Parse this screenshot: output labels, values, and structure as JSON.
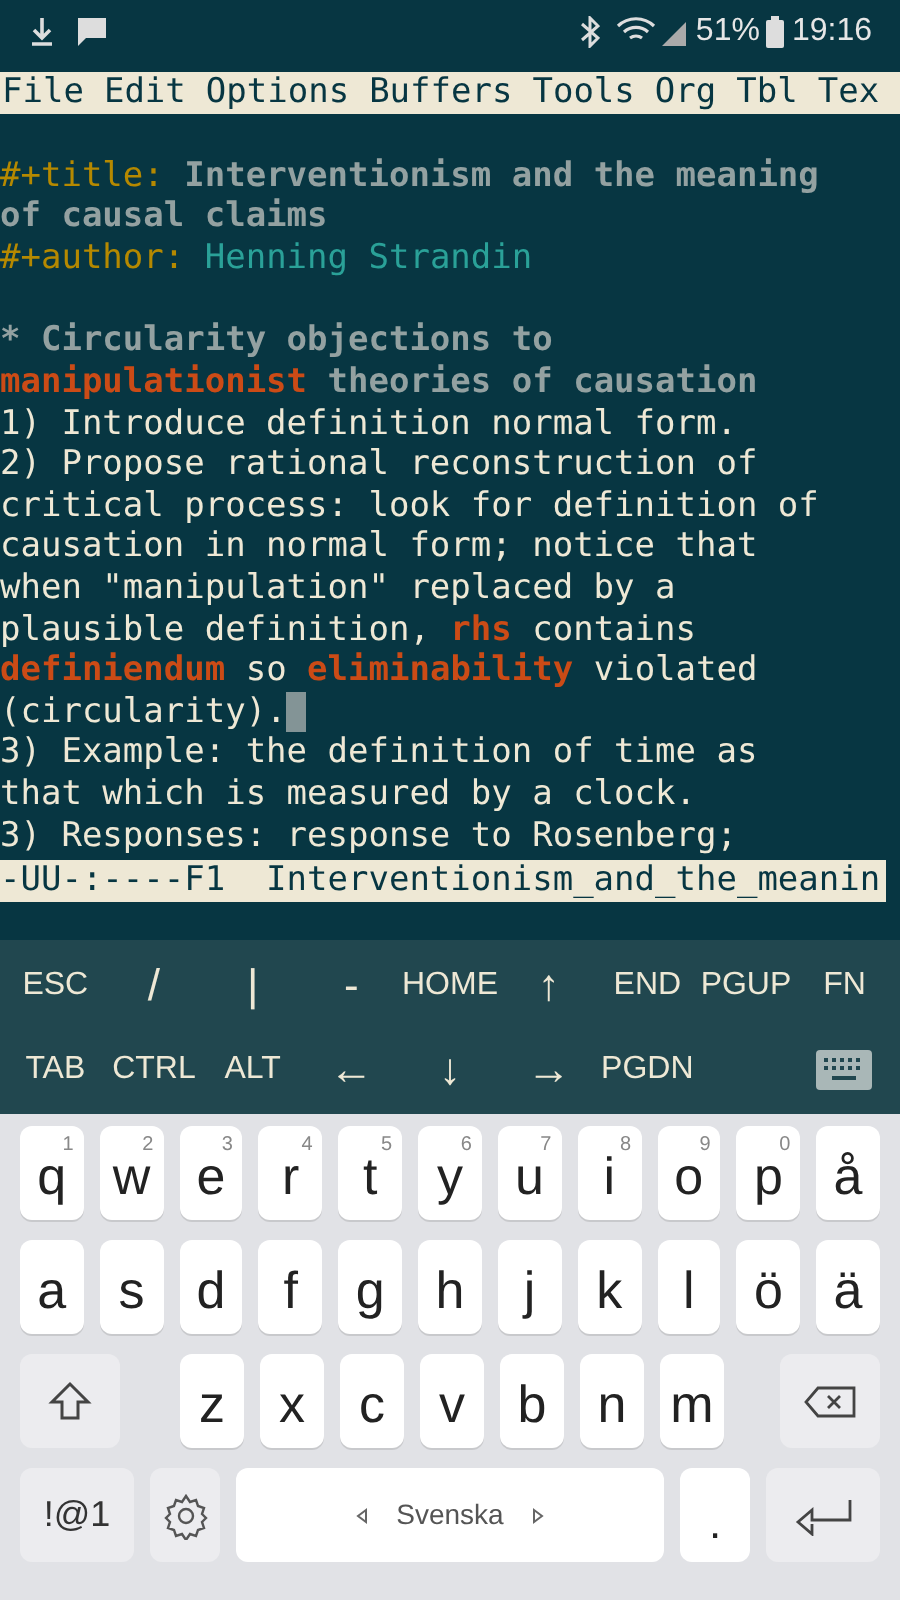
{
  "status_bar": {
    "battery": "51%",
    "time": "19:16"
  },
  "menu_bar": [
    "File",
    "Edit",
    "Options",
    "Buffers",
    "Tools",
    "Org",
    "Tbl",
    "Tex"
  ],
  "editor": {
    "lines": [
      {
        "kind": "blank"
      },
      {
        "segments": [
          {
            "kind": "keyword",
            "text": "#+title:"
          },
          {
            "kind": "title",
            "text": " Interventionism and the meaning"
          }
        ]
      },
      {
        "segments": [
          {
            "kind": "title",
            "text": "of causal claims"
          }
        ]
      },
      {
        "segments": [
          {
            "kind": "keyword",
            "text": "#+author:"
          },
          {
            "kind": "author",
            "text": " Henning Strandin"
          }
        ]
      },
      {
        "kind": "blank"
      },
      {
        "segments": [
          {
            "kind": "heading",
            "text": "* Circularity objections to"
          }
        ]
      },
      {
        "segments": [
          {
            "kind": "highlight",
            "text": "manipulationist"
          },
          {
            "kind": "heading",
            "text": " theories of causation"
          }
        ]
      },
      {
        "segments": [
          {
            "kind": "plain",
            "text": "1) Introduce definition normal form."
          }
        ]
      },
      {
        "segments": [
          {
            "kind": "plain",
            "text": "2) Propose rational reconstruction of"
          }
        ]
      },
      {
        "segments": [
          {
            "kind": "plain",
            "text": "critical process: look for definition of"
          }
        ]
      },
      {
        "segments": [
          {
            "kind": "plain",
            "text": "causation in normal form; notice that"
          }
        ]
      },
      {
        "segments": [
          {
            "kind": "plain",
            "text": "when \"manipulation\" replaced by a"
          }
        ]
      },
      {
        "segments": [
          {
            "kind": "plain",
            "text": "plausible definition, "
          },
          {
            "kind": "highlight",
            "text": "rhs"
          },
          {
            "kind": "plain",
            "text": " contains"
          }
        ]
      },
      {
        "segments": [
          {
            "kind": "highlight",
            "text": "definiendum"
          },
          {
            "kind": "plain",
            "text": " so "
          },
          {
            "kind": "highlight",
            "text": "eliminability"
          },
          {
            "kind": "plain",
            "text": " violated"
          }
        ]
      },
      {
        "segments": [
          {
            "kind": "plain",
            "text": "(circularity)."
          }
        ],
        "cursor": true
      },
      {
        "segments": [
          {
            "kind": "plain",
            "text": "3) Example: the definition of time as"
          }
        ]
      },
      {
        "segments": [
          {
            "kind": "plain",
            "text": "that which is measured by a clock."
          }
        ]
      },
      {
        "segments": [
          {
            "kind": "plain",
            "text": "3) Responses: response to Rosenberg;"
          }
        ]
      }
    ]
  },
  "mode_line": "-UU-:----F1  Interventionism_and_the_meanin",
  "extra_keys": [
    [
      "ESC",
      "/",
      "|",
      "-",
      "HOME",
      "↑",
      "END",
      "PGUP",
      "FN"
    ],
    [
      "TAB",
      "CTRL",
      "ALT",
      "←",
      "↓",
      "→",
      "PGDN"
    ]
  ],
  "keyboard": {
    "top_row": [
      {
        "label": "q",
        "hint": "1"
      },
      {
        "label": "w",
        "hint": "2"
      },
      {
        "label": "e",
        "hint": "3"
      },
      {
        "label": "r",
        "hint": "4"
      },
      {
        "label": "t",
        "hint": "5"
      },
      {
        "label": "y",
        "hint": "6"
      },
      {
        "label": "u",
        "hint": "7"
      },
      {
        "label": "i",
        "hint": "8"
      },
      {
        "label": "o",
        "hint": "9"
      },
      {
        "label": "p",
        "hint": "0"
      },
      {
        "label": "å"
      }
    ],
    "home_row": [
      {
        "label": "a"
      },
      {
        "label": "s"
      },
      {
        "label": "d"
      },
      {
        "label": "f"
      },
      {
        "label": "g"
      },
      {
        "label": "h"
      },
      {
        "label": "j"
      },
      {
        "label": "k"
      },
      {
        "label": "l"
      },
      {
        "label": "ö"
      },
      {
        "label": "ä"
      }
    ],
    "bottom_row": [
      {
        "label": "z"
      },
      {
        "label": "x"
      },
      {
        "label": "c"
      },
      {
        "label": "v"
      },
      {
        "label": "b"
      },
      {
        "label": "n"
      },
      {
        "label": "m"
      }
    ],
    "symbols": "!@1",
    "space": "Svenska",
    "period": "."
  }
}
